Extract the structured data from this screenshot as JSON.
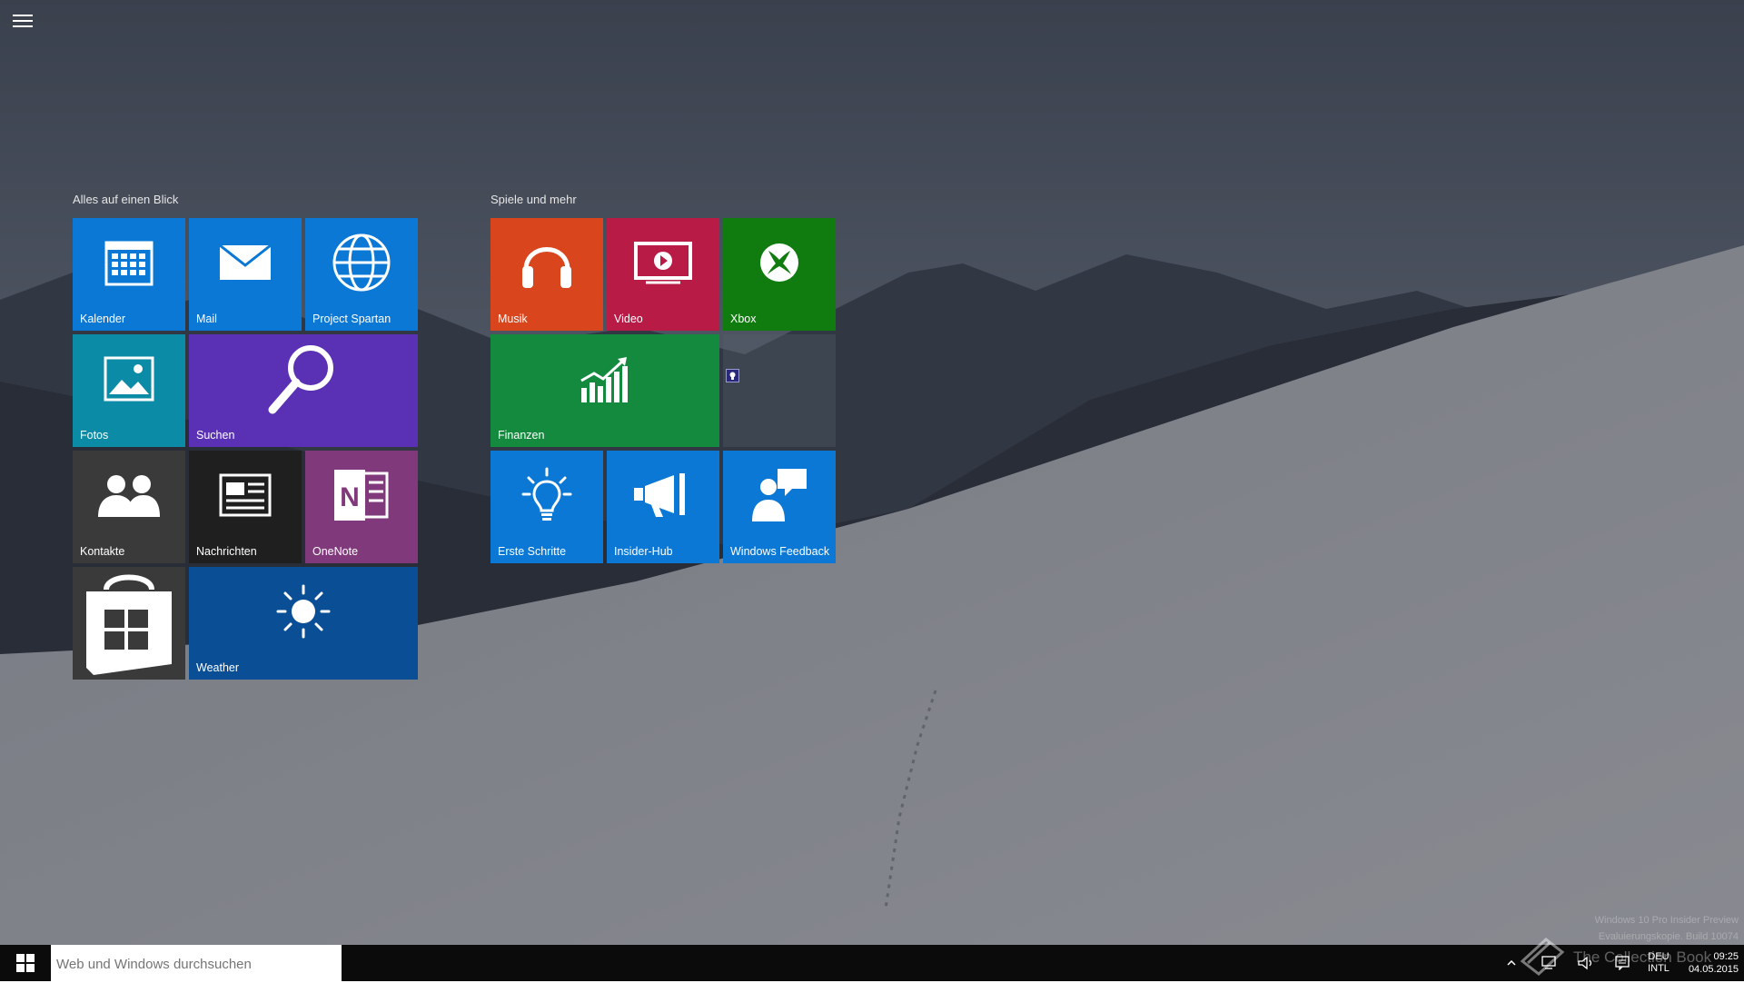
{
  "start_menu": {
    "menu_icon": "hamburger-icon",
    "groups": [
      {
        "label": "Alles auf einen Blick",
        "tiles": [
          {
            "label": "Kalender",
            "icon": "calendar-icon",
            "color": "#0a78d4"
          },
          {
            "label": "Mail",
            "icon": "mail-icon",
            "color": "#0a78d4"
          },
          {
            "label": "Project Spartan",
            "icon": "globe-icon",
            "color": "#0a78d4"
          },
          {
            "label": "Fotos",
            "icon": "photos-icon",
            "color": "#0b8ba5"
          },
          {
            "label": "Suchen",
            "icon": "search-icon",
            "color": "#5a30b4"
          },
          {
            "label": "Kontakte",
            "icon": "people-icon",
            "color": "#3a3a3a"
          },
          {
            "label": "Nachrichten",
            "icon": "news-icon",
            "color": "#1f1f1f"
          },
          {
            "label": "OneNote",
            "icon": "onenote-icon",
            "color": "#80397b"
          },
          {
            "label": "",
            "icon": "store-icon",
            "color": "#3a3a3a"
          },
          {
            "label": "Weather",
            "icon": "sun-icon",
            "color": "#0a4f96"
          }
        ]
      },
      {
        "label": "Spiele und mehr",
        "tiles": [
          {
            "label": "Musik",
            "icon": "headphones-icon",
            "color": "#d9461e"
          },
          {
            "label": "Video",
            "icon": "video-icon",
            "color": "#b81c46"
          },
          {
            "label": "Xbox",
            "icon": "xbox-icon",
            "color": "#107c10"
          },
          {
            "label": "Finanzen",
            "icon": "finance-chart-icon",
            "color": "#138a3e"
          },
          {
            "label": "",
            "icon": "small-badge-icon",
            "color": "#55606c"
          },
          {
            "label": "Erste Schritte",
            "icon": "lightbulb-icon",
            "color": "#0a78d4"
          },
          {
            "label": "Insider-Hub",
            "icon": "megaphone-icon",
            "color": "#0a78d4"
          },
          {
            "label": "Windows Feedback",
            "icon": "feedback-icon",
            "color": "#0a78d4"
          }
        ]
      }
    ]
  },
  "taskbar": {
    "start_icon": "windows-logo-icon",
    "search_placeholder": "Web und Windows durchsuchen",
    "tray": {
      "chevron_icon": "chevron-up-icon",
      "network_icon": "network-icon",
      "volume_icon": "volume-icon",
      "notifications_icon": "action-center-icon",
      "language_top": "DEU",
      "language_bottom": "INTL",
      "time": "09:25",
      "date": "04.05.2015"
    }
  },
  "watermark": {
    "line1": "Windows 10 Pro Insider Preview",
    "line2": "Evaluierungskopie. Build 10074",
    "overlay_text": "The Collection Book"
  }
}
